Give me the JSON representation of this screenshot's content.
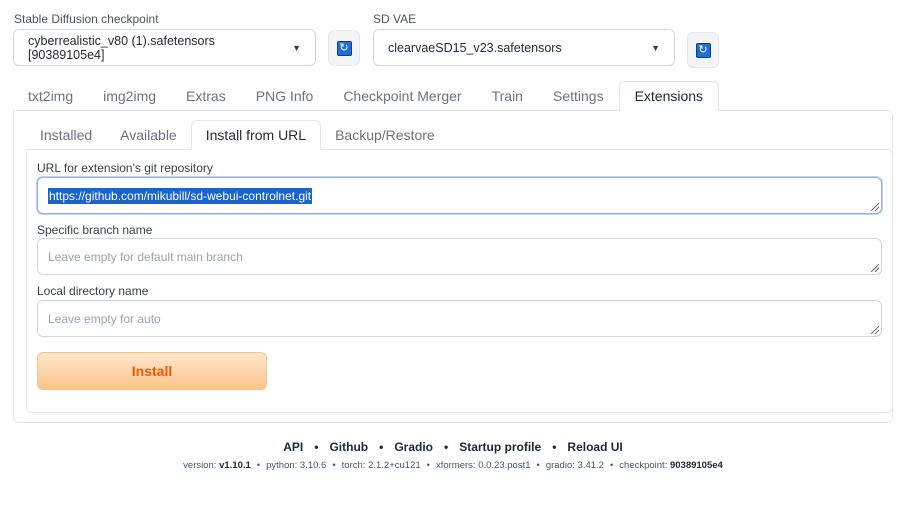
{
  "top": {
    "checkpoint": {
      "label": "Stable Diffusion checkpoint",
      "value": "cyberrealistic_v80 (1).safetensors [90389105e4]"
    },
    "vae": {
      "label": "SD VAE",
      "value": "clearvaeSD15_v23.safetensors"
    }
  },
  "tabs": [
    "txt2img",
    "img2img",
    "Extras",
    "PNG Info",
    "Checkpoint Merger",
    "Train",
    "Settings",
    "Extensions"
  ],
  "subtabs": [
    "Installed",
    "Available",
    "Install from URL",
    "Backup/Restore"
  ],
  "form": {
    "url_label": "URL for extension's git repository",
    "url_value": "https://github.com/mikubill/sd-webui-controlnet.git",
    "branch_label": "Specific branch name",
    "branch_placeholder": "Leave empty for default main branch",
    "dir_label": "Local directory name",
    "dir_placeholder": "Leave empty for auto",
    "install_label": "Install"
  },
  "footer": {
    "links": [
      "API",
      "Github",
      "Gradio",
      "Startup profile",
      "Reload UI"
    ],
    "versions": {
      "version_key": "version:",
      "version_val": "v1.10.1",
      "python_key": "python:",
      "python_val": "3.10.6",
      "torch_key": "torch:",
      "torch_val": "2.1.2+cu121",
      "xformers_key": "xformers:",
      "xformers_val": "0.0.23.post1",
      "gradio_key": "gradio:",
      "gradio_val": "3.41.2",
      "checkpoint_key": "checkpoint:",
      "checkpoint_val": "90389105e4"
    }
  },
  "colors": {
    "accent_orange": "#ea580c",
    "refresh_blue": "#1e6fd0",
    "selection_blue": "#1a64cc"
  }
}
